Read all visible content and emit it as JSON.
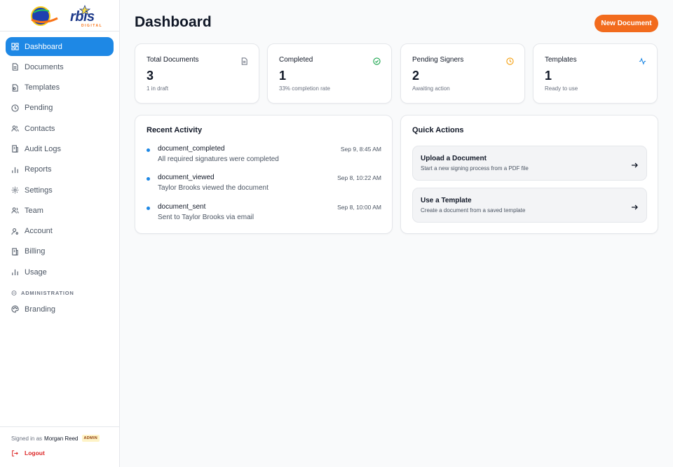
{
  "brand": {
    "name": "rbis",
    "sub": "DIGITAL"
  },
  "sidebar": {
    "items": [
      {
        "label": "Dashboard",
        "icon": "dashboard-icon",
        "active": true
      },
      {
        "label": "Documents",
        "icon": "document-icon"
      },
      {
        "label": "Templates",
        "icon": "template-icon"
      },
      {
        "label": "Pending",
        "icon": "clock-icon"
      },
      {
        "label": "Contacts",
        "icon": "users-icon"
      },
      {
        "label": "Audit Logs",
        "icon": "audit-log-icon"
      },
      {
        "label": "Reports",
        "icon": "bar-chart-icon"
      },
      {
        "label": "Settings",
        "icon": "gear-icon"
      },
      {
        "label": "Team",
        "icon": "team-icon"
      },
      {
        "label": "Account",
        "icon": "account-icon"
      },
      {
        "label": "Billing",
        "icon": "billing-icon"
      },
      {
        "label": "Usage",
        "icon": "usage-chart-icon"
      }
    ],
    "section_label": "ADMINISTRATION",
    "admin_items": [
      {
        "label": "Branding",
        "icon": "palette-icon"
      }
    ],
    "footer": {
      "signed_in_prefix": "Signed in as",
      "user_name": "Morgan Reed",
      "role_badge": "ADMIN",
      "logout_label": "Logout"
    }
  },
  "header": {
    "title": "Dashboard",
    "new_document_label": "New Document"
  },
  "stats": [
    {
      "label": "Total Documents",
      "value": "3",
      "sub": "1 in draft",
      "icon": "document-icon",
      "color": "#6b7280"
    },
    {
      "label": "Completed",
      "value": "1",
      "sub": "33% completion rate",
      "icon": "check-circle-icon",
      "color": "#16a34a"
    },
    {
      "label": "Pending Signers",
      "value": "2",
      "sub": "Awaiting action",
      "icon": "clock-icon",
      "color": "#f59e0b"
    },
    {
      "label": "Templates",
      "value": "1",
      "sub": "Ready to use",
      "icon": "activity-icon",
      "color": "#1e88e5"
    }
  ],
  "recent_activity": {
    "title": "Recent Activity",
    "items": [
      {
        "event": "document_completed",
        "description": "All required signatures were completed",
        "time": "Sep 9, 8:45 AM"
      },
      {
        "event": "document_viewed",
        "description": "Taylor Brooks viewed the document",
        "time": "Sep 8, 10:22 AM"
      },
      {
        "event": "document_sent",
        "description": "Sent to Taylor Brooks via email",
        "time": "Sep 8, 10:00 AM"
      }
    ]
  },
  "quick_actions": {
    "title": "Quick Actions",
    "items": [
      {
        "title": "Upload a Document",
        "description": "Start a new signing process from a PDF file"
      },
      {
        "title": "Use a Template",
        "description": "Create a document from a saved template"
      }
    ]
  },
  "colors": {
    "accent": "#1e88e5",
    "cta": "#f26b1d",
    "danger": "#dc2626"
  }
}
